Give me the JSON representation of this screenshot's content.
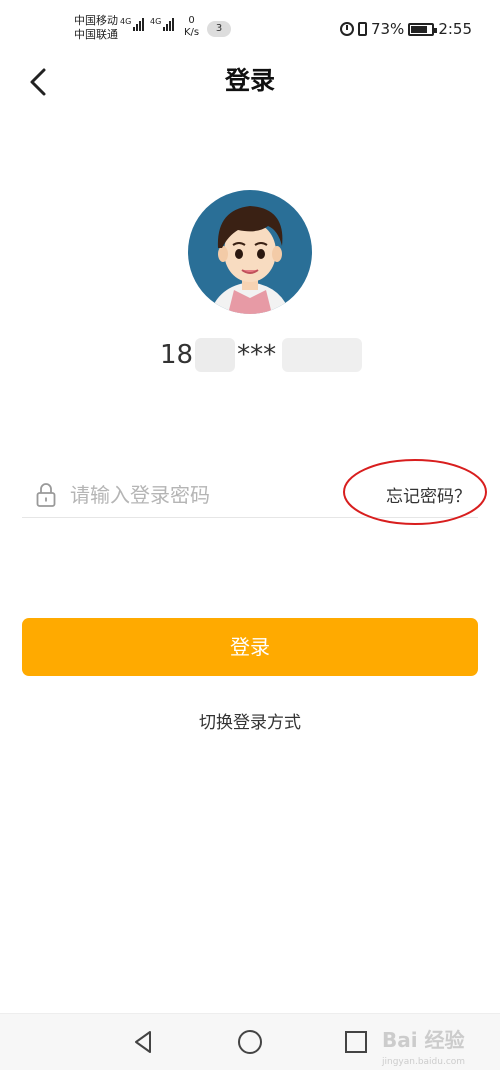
{
  "status_bar": {
    "carrier_1": "中国移动",
    "carrier_2": "中国联通",
    "signal_1_label": "4G",
    "signal_2_label": "4G",
    "net_speed_value": "0",
    "net_speed_unit": "K/s",
    "notification_count": "3",
    "battery": "73%",
    "time": "2:55"
  },
  "header": {
    "back_icon": "chevron-left-icon",
    "title": "登录"
  },
  "profile": {
    "avatar_icon": "cartoon-boy-avatar",
    "account_prefix": "18",
    "account_masked": "***"
  },
  "password": {
    "lock_icon": "lock-icon",
    "placeholder": "请输入登录密码",
    "forgot_label": "忘记密码？",
    "annotation_color": "#d81e1e"
  },
  "actions": {
    "login_label": "登录",
    "login_color": "#ffaa00",
    "switch_label": "切换登录方式"
  },
  "nav_bar": {
    "back_icon": "triangle-back-icon",
    "home_icon": "circle-home-icon",
    "recent_icon": "square-recent-icon",
    "watermark_text": "Bai 经验",
    "watermark_sub": "jingyan.baidu.com"
  }
}
